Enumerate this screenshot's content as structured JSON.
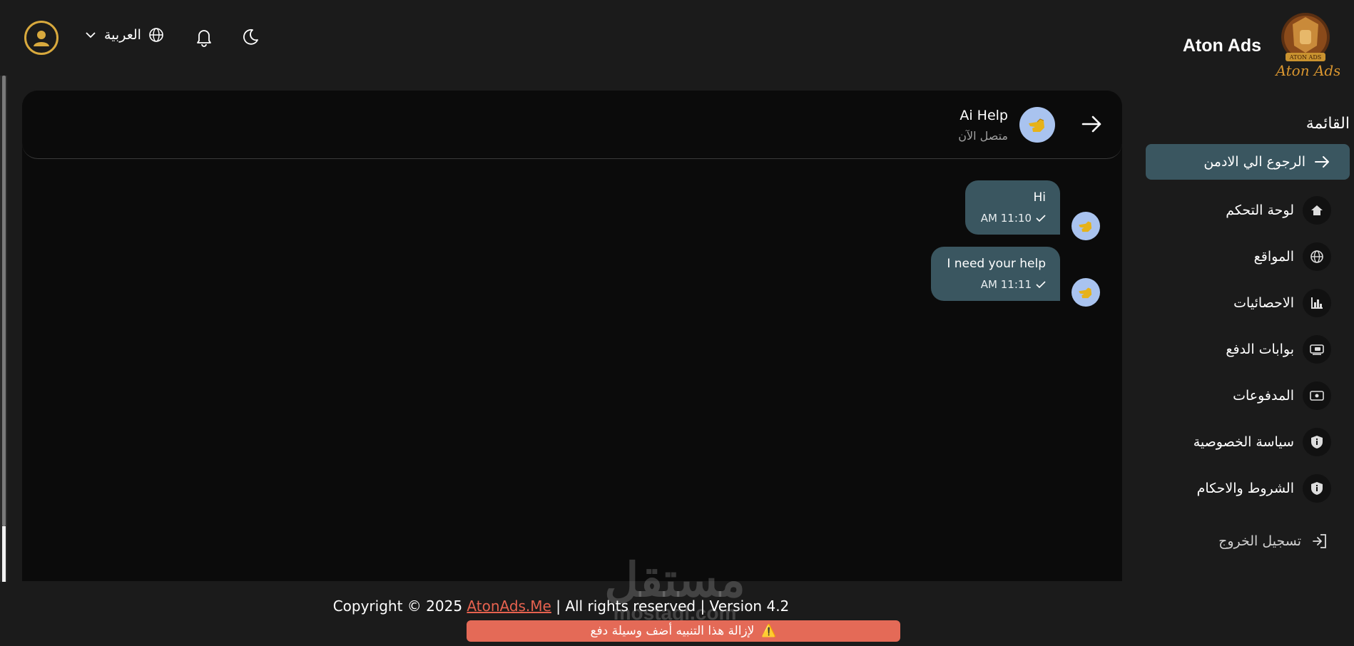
{
  "header": {
    "language_label": "العربية",
    "brand_name": "Aton Ads",
    "logo_text_top": "ATON ADS",
    "logo_text_bottom": "Aton Ads"
  },
  "sidebar": {
    "title": "القائمة",
    "back_label": "الرجوع الي الادمن",
    "items": [
      {
        "label": "لوحة التحكم",
        "icon": "home-icon"
      },
      {
        "label": "المواقع",
        "icon": "globe-icon"
      },
      {
        "label": "الاحصائيات",
        "icon": "chart-icon"
      },
      {
        "label": "بوابات الدفع",
        "icon": "payment-gateway-icon"
      },
      {
        "label": "المدفوعات",
        "icon": "cash-icon"
      },
      {
        "label": "سياسة الخصوصية",
        "icon": "shield-icon"
      },
      {
        "label": "الشروط والاحكام",
        "icon": "shield-icon"
      }
    ],
    "logout_label": "تسجيل الخروج"
  },
  "chat": {
    "contact_name": "Ai Help",
    "contact_status": "متصل الآن",
    "messages": [
      {
        "text": "Hi",
        "time": "AM 11:10"
      },
      {
        "text": "I need your help",
        "time": "AM 11:11"
      }
    ]
  },
  "footer": {
    "copyright_prefix": "Copyright © 2025",
    "link_text": "AtonAds.Me",
    "copyright_suffix": " | All rights reserved | Version 4.2",
    "warning_text": "لإزالة هذا التنبيه أضف وسيلة دفع",
    "warning_icon": "⚠️"
  },
  "watermark": {
    "line1": "مستقل",
    "line2": "mostaql.com"
  },
  "colors": {
    "accent": "#3a5660",
    "warning": "#e46a57",
    "link": "#e6624f",
    "gold": "#d8a93d"
  }
}
